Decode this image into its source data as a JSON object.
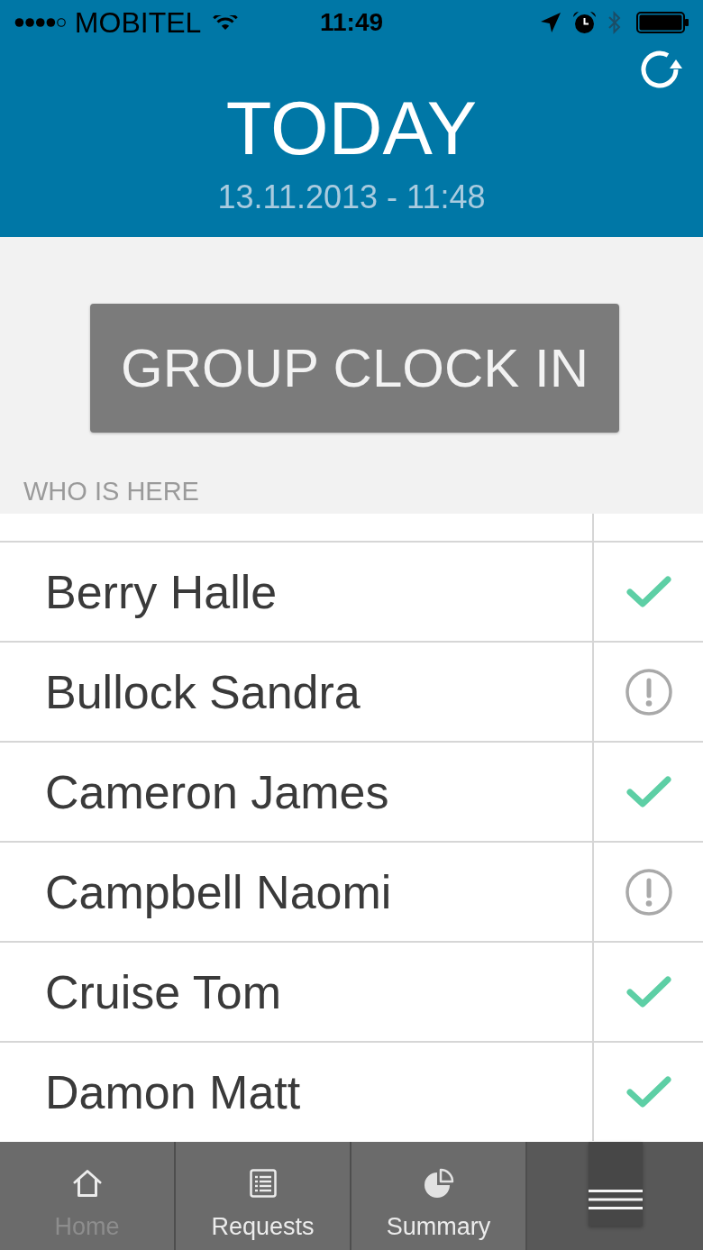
{
  "status_bar": {
    "carrier": "MOBITEL",
    "time": "11:49"
  },
  "header": {
    "title": "TODAY",
    "subtitle": "13.11.2013 - 11:48"
  },
  "action_button": {
    "label": "GROUP CLOCK IN"
  },
  "section_title": "WHO IS HERE",
  "people": [
    {
      "name": "Berry Halle",
      "kind": "check"
    },
    {
      "name": "Bullock Sandra",
      "kind": "alert"
    },
    {
      "name": "Cameron James",
      "kind": "check"
    },
    {
      "name": "Campbell Naomi",
      "kind": "alert"
    },
    {
      "name": "Cruise Tom",
      "kind": "check"
    },
    {
      "name": "Damon Matt",
      "kind": "check"
    }
  ],
  "tab_bar": {
    "tabs": [
      {
        "label": "Home",
        "selected": true
      },
      {
        "label": "Requests",
        "selected": false
      },
      {
        "label": "Summary",
        "selected": false
      }
    ]
  }
}
